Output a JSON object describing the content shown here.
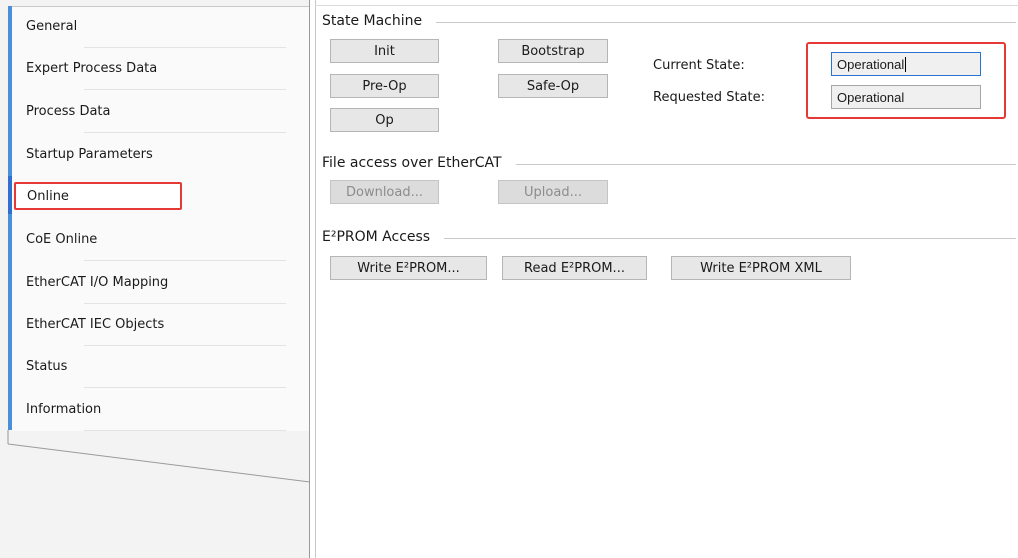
{
  "sidebar": {
    "items": [
      {
        "label": "General"
      },
      {
        "label": "Expert Process Data"
      },
      {
        "label": "Process Data"
      },
      {
        "label": "Startup Parameters"
      },
      {
        "label": "Online"
      },
      {
        "label": "CoE Online"
      },
      {
        "label": "EtherCAT I/O Mapping"
      },
      {
        "label": "EtherCAT IEC Objects"
      },
      {
        "label": "Status"
      },
      {
        "label": "Information"
      }
    ],
    "selected": "Online"
  },
  "state_machine": {
    "title": "State Machine",
    "buttons": {
      "init": "Init",
      "bootstrap": "Bootstrap",
      "preop": "Pre-Op",
      "safeop": "Safe-Op",
      "op": "Op"
    },
    "current_state_label": "Current State:",
    "current_state_value": "Operational",
    "requested_state_label": "Requested State:",
    "requested_state_value": "Operational"
  },
  "file_access": {
    "title": "File access over EtherCAT",
    "download": "Download...",
    "upload": "Upload..."
  },
  "eeprom": {
    "title": "E²PROM Access",
    "write": "Write E²PROM...",
    "read": "Read E²PROM...",
    "write_xml": "Write E²PROM XML"
  },
  "colors": {
    "accent": "#4a90d9",
    "highlight": "#e53935",
    "focus": "#2a72d6"
  }
}
